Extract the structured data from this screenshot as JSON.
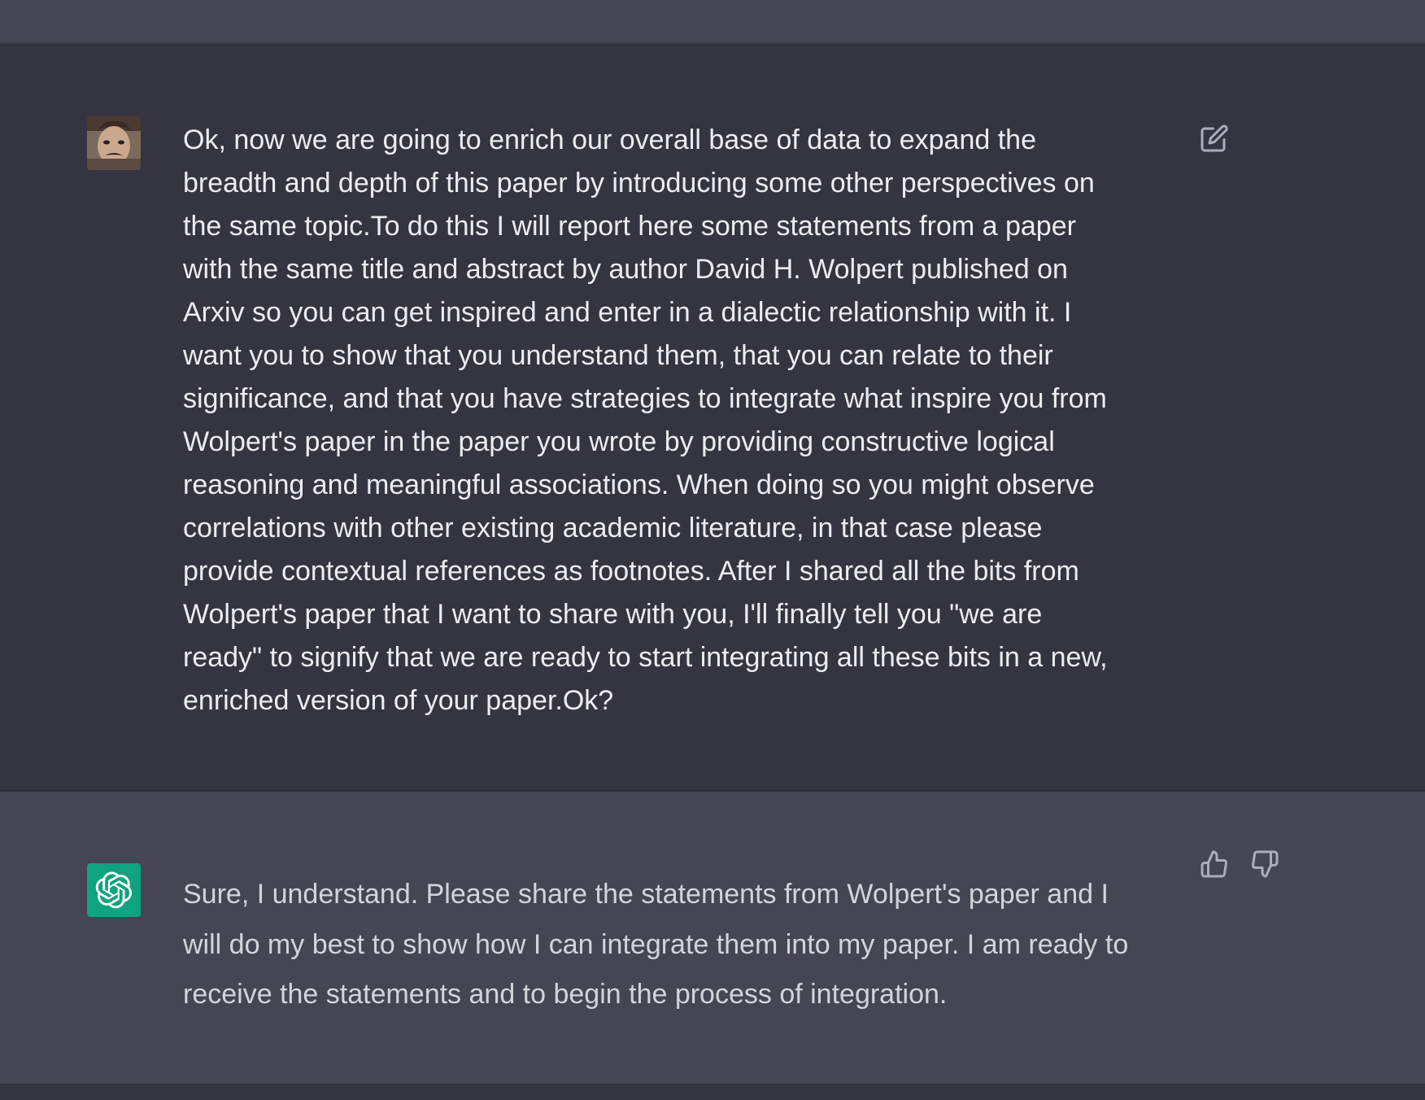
{
  "conversation": {
    "user_message": {
      "author": "user",
      "avatar_icon": "user-photo-avatar",
      "text": "Ok, now we are going to enrich our overall base of data to expand the\nbreadth and depth of this paper by introducing some other perspectives on\nthe same topic.To do this I will report here some statements from a paper\nwith the same title and abstract by author David H. Wolpert published on\nArxiv so you can get inspired and enter in a dialectic relationship with it. I\nwant you to show that you understand them, that you can relate to their\nsignificance, and that you have strategies to integrate what inspire you from\nWolpert's paper in the paper you wrote by providing constructive logical\nreasoning and meaningful associations. When doing so you might observe\ncorrelations with other existing academic literature, in that case please\nprovide contextual references as footnotes.  After I shared all the bits from\nWolpert's paper that I want to share with you, I'll finally tell you \"we are\nready\" to signify that we are ready to start integrating all these bits in a new,\nenriched version of your paper.Ok?",
      "actions": {
        "edit_icon": "edit-icon"
      }
    },
    "assistant_message": {
      "author": "assistant",
      "avatar_icon": "openai-logo-icon",
      "text": "Sure, I understand. Please share the statements from Wolpert's paper and I\nwill do my best to show how I can integrate them into my paper. I am ready to\nreceive the statements and to begin the process of integration.",
      "actions": {
        "thumbs_up_icon": "thumbs-up-icon",
        "thumbs_down_icon": "thumbs-down-icon"
      }
    }
  },
  "colors": {
    "user_bg": "#343541",
    "assistant_bg": "#444654",
    "text": "#ececf1",
    "assistant_text": "#d1d5db",
    "icon": "#acacbe",
    "brand_green": "#10a37f"
  }
}
